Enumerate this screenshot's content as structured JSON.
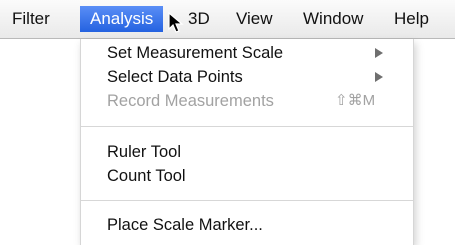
{
  "menubar": {
    "items": [
      {
        "label": "Filter"
      },
      {
        "label": "Analysis",
        "active": true
      },
      {
        "label": "3D"
      },
      {
        "label": "View"
      },
      {
        "label": "Window"
      },
      {
        "label": "Help"
      }
    ]
  },
  "dropdown": {
    "items": [
      {
        "label": "Set Measurement Scale",
        "submenu": true,
        "enabled": true
      },
      {
        "label": "Select Data Points",
        "submenu": true,
        "enabled": true
      },
      {
        "label": "Record Measurements",
        "shortcut": "⇧⌘M",
        "enabled": false
      },
      {
        "label": "Ruler Tool",
        "enabled": true
      },
      {
        "label": "Count Tool",
        "enabled": true
      },
      {
        "label": "Place Scale Marker...",
        "enabled": true
      }
    ]
  },
  "colors": {
    "highlight": "#2f6fe8",
    "disabled_text": "#a2a2a2"
  },
  "icons": {
    "pointer": "arrow-cursor-icon",
    "submenu": "triangle-right-icon"
  }
}
